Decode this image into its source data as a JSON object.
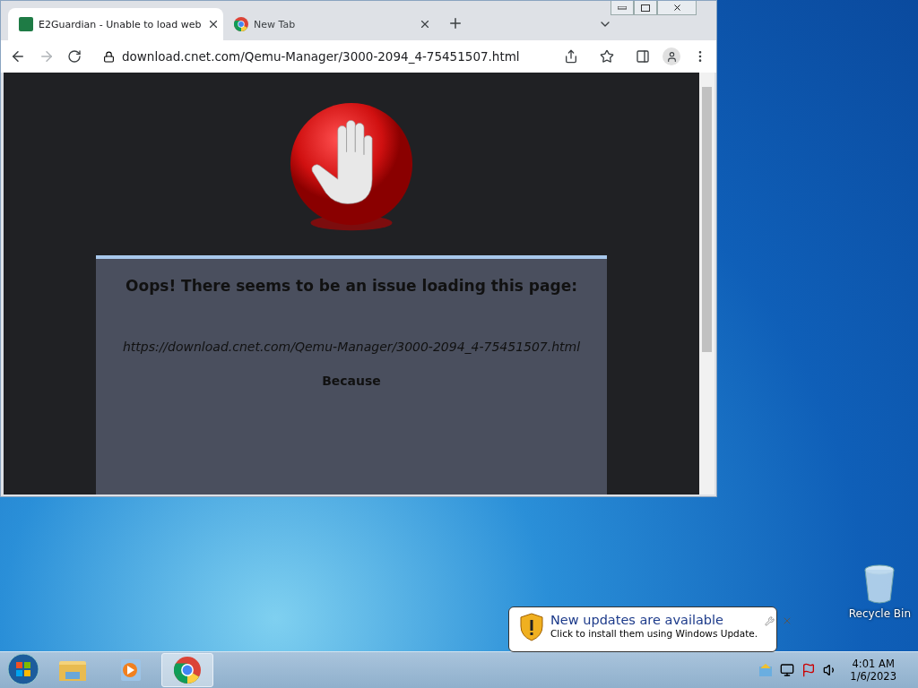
{
  "browser": {
    "tabs": [
      {
        "title": "E2Guardian - Unable to load web",
        "selected": true,
        "kind": "site"
      },
      {
        "title": "New Tab",
        "selected": false,
        "kind": "newtab"
      }
    ],
    "address": "download.cnet.com/Qemu-Manager/3000-2094_4-75451507.html",
    "page": {
      "heading": "Oops! There seems to be an issue loading this page:",
      "url": "https://download.cnet.com/Qemu-Manager/3000-2094_4-75451507.html",
      "because": "Because"
    }
  },
  "desktop": {
    "icons": [
      {
        "label": "Recycle Bin"
      }
    ]
  },
  "notification": {
    "title": "New updates are available",
    "message": "Click to install them using Windows Update."
  },
  "taskbar": {
    "apps": [
      {
        "kind": "explorer",
        "selected": false
      },
      {
        "kind": "media",
        "selected": false
      },
      {
        "kind": "chrome",
        "selected": true
      }
    ],
    "clock": {
      "time": "4:01 AM",
      "date": "1/6/2023"
    }
  }
}
